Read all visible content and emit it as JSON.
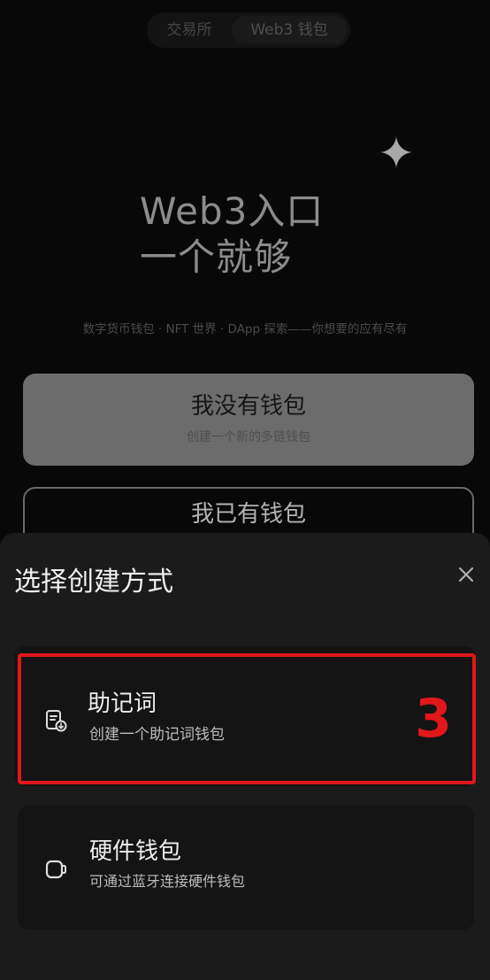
{
  "header": {
    "tabs": [
      {
        "label": "交易所"
      },
      {
        "label": "Web3 钱包"
      }
    ],
    "active_tab": "Web3 钱包"
  },
  "hero": {
    "icon": "sparkle-icon",
    "title_line1": "Web3入口",
    "title_line2": "一个就够",
    "subtitle": "数字货币钱包 · NFT 世界 · DApp 探索——你想要的应有尽有"
  },
  "actions": {
    "no_wallet": {
      "label": "我没有钱包",
      "sublabel": "创建一个新的多链钱包"
    },
    "have_wallet": {
      "label": "我已有钱包"
    }
  },
  "sheet": {
    "title": "选择创建方式",
    "close_icon": "close-icon",
    "options": [
      {
        "icon": "seed-phrase-icon",
        "label": "助记词",
        "description": "创建一个助记词钱包"
      },
      {
        "icon": "hardware-wallet-icon",
        "label": "硬件钱包",
        "description": "可通过蓝牙连接硬件钱包"
      }
    ]
  },
  "annotation": {
    "step_number": "3",
    "color": "#e0171b"
  }
}
